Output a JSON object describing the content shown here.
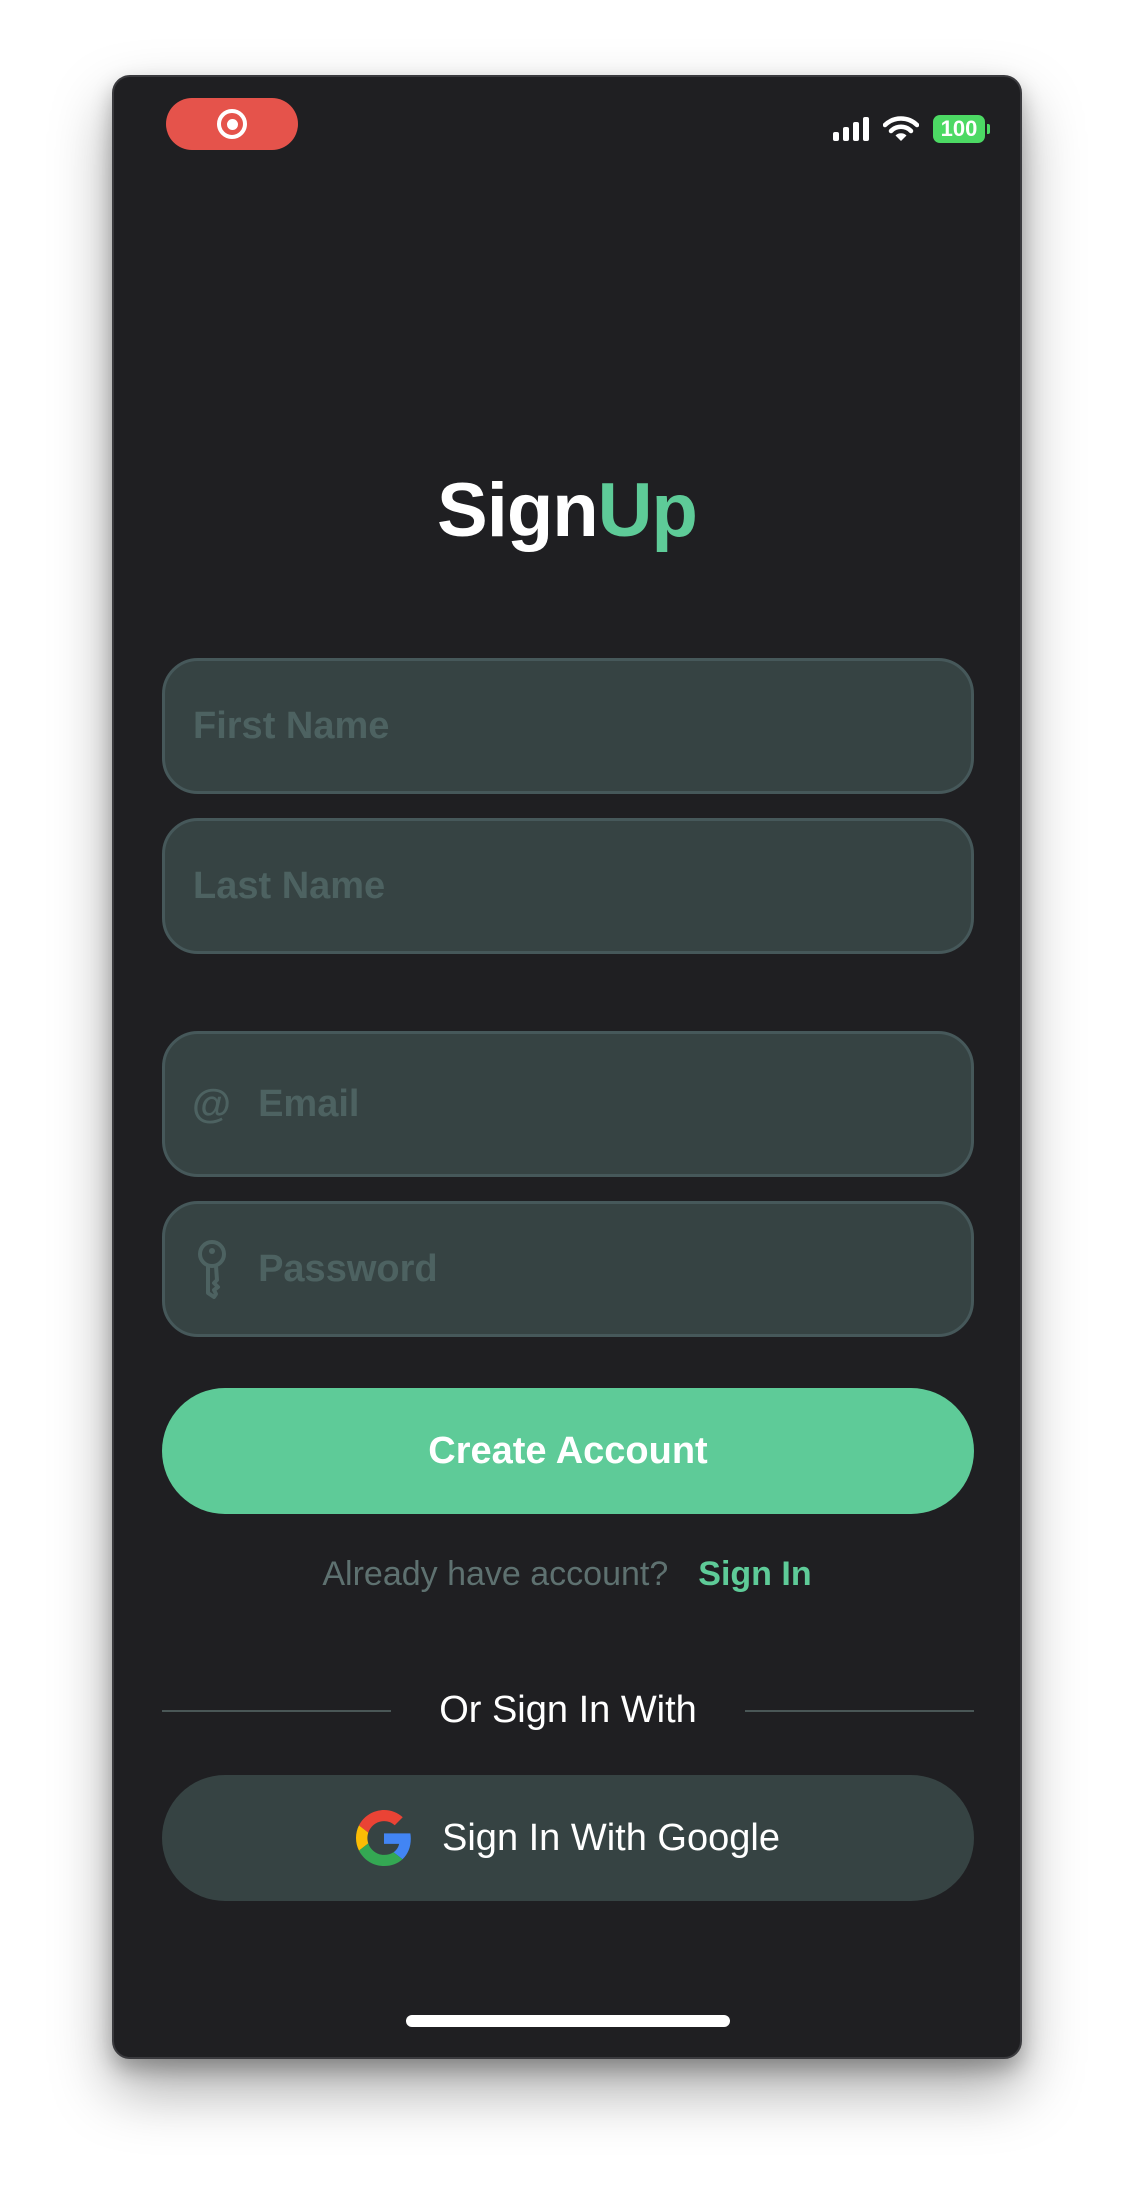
{
  "status_bar": {
    "battery": "100",
    "recording_icon": "record-icon",
    "signal_icon": "cellular-signal-icon",
    "wifi_icon": "wifi-icon"
  },
  "title": {
    "part1": "Sign",
    "part2": "Up"
  },
  "form": {
    "first_name_placeholder": "First Name",
    "last_name_placeholder": "Last Name",
    "email_placeholder": "Email",
    "email_icon": "@",
    "password_placeholder": "Password",
    "password_icon": "key-icon"
  },
  "create_account_label": "Create Account",
  "signin_prompt": {
    "question": "Already have account?",
    "link": "Sign In"
  },
  "divider_text": "Or Sign In With",
  "google_button_label": "Sign In With Google",
  "colors": {
    "background": "#1f1f22",
    "accent": "#5ecb98",
    "field_bg": "#364343",
    "record_red": "#e5534b"
  }
}
